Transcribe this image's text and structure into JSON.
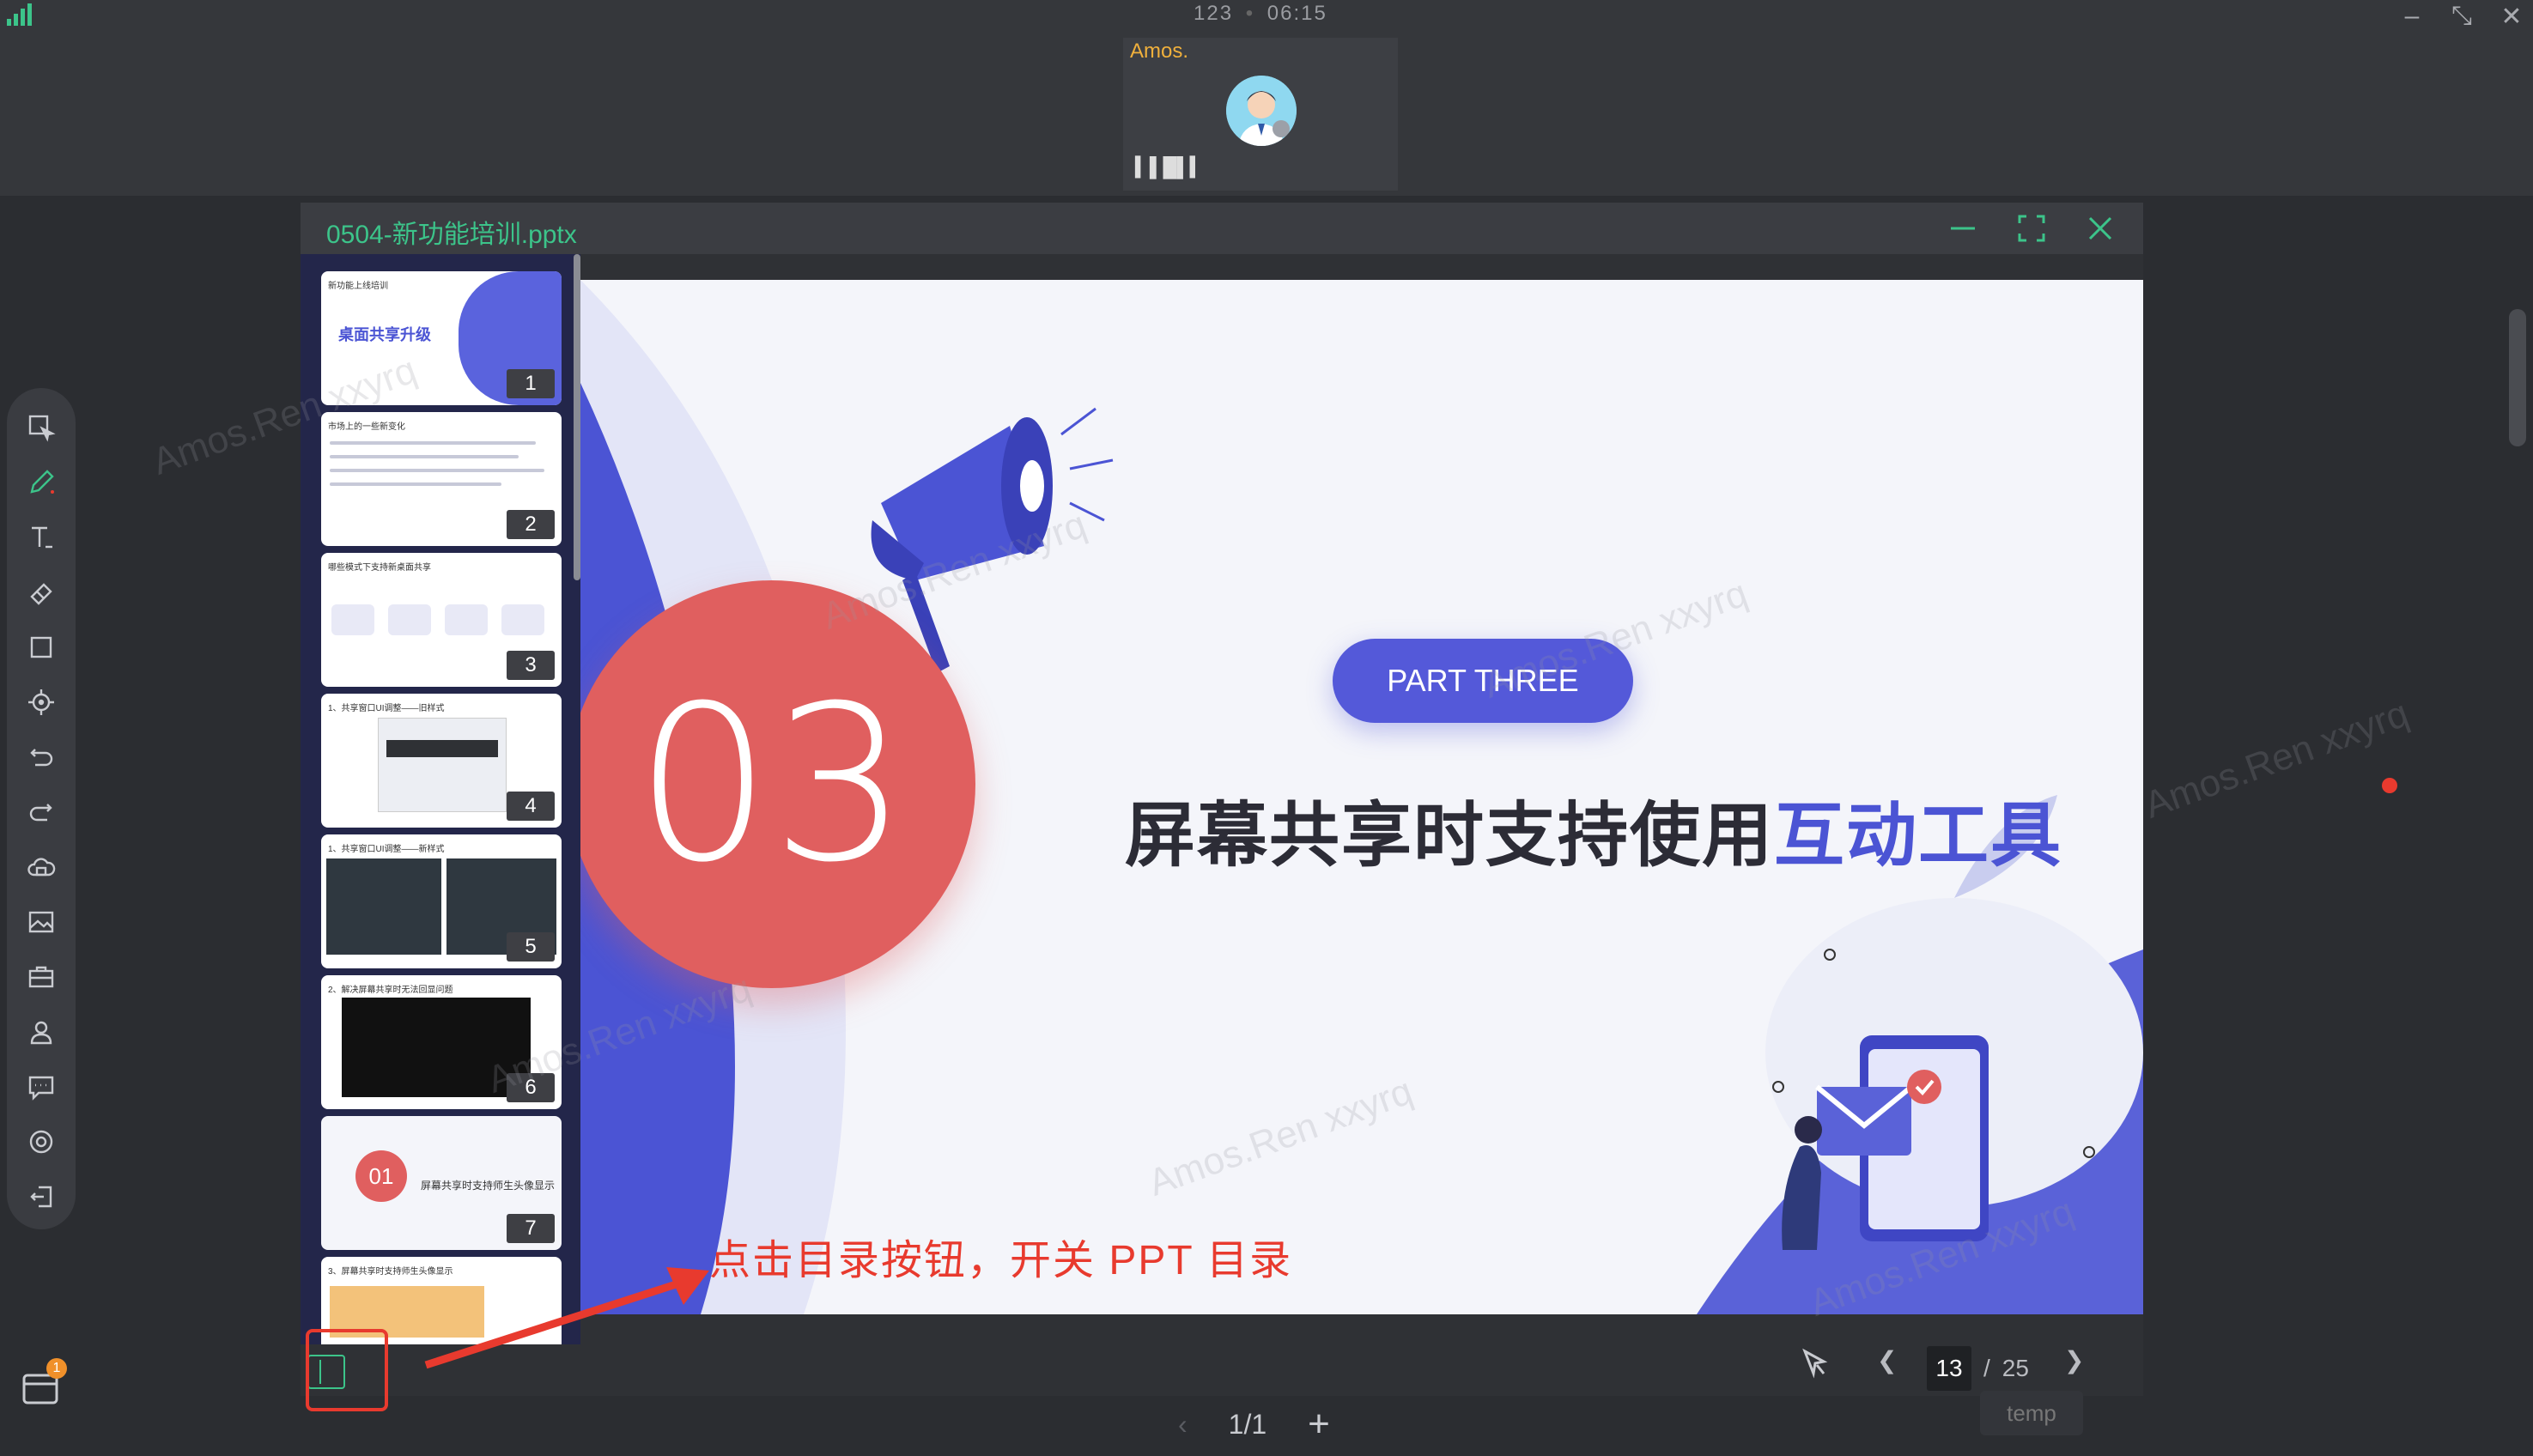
{
  "topbar": {
    "meeting_id": "123",
    "time": "06:15",
    "separator": "•",
    "minimize_icon": "minimize-icon",
    "restore_icon": "restore-icon",
    "close_icon": "close-icon"
  },
  "participant": {
    "name": "Amos.",
    "mic_icon": "audio-wave-icon"
  },
  "toolbar": {
    "tools": [
      {
        "name": "select-tool",
        "icon": "cursor-select-icon"
      },
      {
        "name": "pen-tool",
        "icon": "pen-icon",
        "active": true
      },
      {
        "name": "text-tool",
        "icon": "text-icon"
      },
      {
        "name": "eraser-tool",
        "icon": "eraser-icon"
      },
      {
        "name": "shape-tool",
        "icon": "rectangle-icon"
      },
      {
        "name": "laser-tool",
        "icon": "laser-pointer-icon"
      },
      {
        "name": "undo-tool",
        "icon": "undo-icon"
      },
      {
        "name": "redo-tool",
        "icon": "redo-icon"
      },
      {
        "name": "cloud-tool",
        "icon": "cloud-upload-icon"
      },
      {
        "name": "image-tool",
        "icon": "image-icon"
      },
      {
        "name": "toolbox-tool",
        "icon": "toolbox-icon"
      },
      {
        "name": "member-tool",
        "icon": "user-icon"
      },
      {
        "name": "chat-tool",
        "icon": "chat-icon"
      },
      {
        "name": "record-tool",
        "icon": "record-icon"
      },
      {
        "name": "exit-tool",
        "icon": "exit-icon"
      }
    ],
    "app_badge": "1"
  },
  "viewer": {
    "file_name": "0504-新功能培训.pptx",
    "accent": "#3cc48a",
    "thumbnails": [
      {
        "num": "1",
        "title": "新功能上线培训"
      },
      {
        "num": "2",
        "title": "市场上的一些新变化"
      },
      {
        "num": "3",
        "title": "哪些模式下支持新桌面共享"
      },
      {
        "num": "4",
        "title": "1、共享窗口UI调整——旧样式"
      },
      {
        "num": "5",
        "title": "1、共享窗口UI调整——新样式"
      },
      {
        "num": "6",
        "title": "2、解决屏幕共享时无法回显问题"
      },
      {
        "num": "7",
        "title": "屏幕共享时支持师生头像显示"
      },
      {
        "num": "",
        "title": "3、屏幕共享时支持师生头像显示"
      }
    ],
    "slide": {
      "part_label": "PART THREE",
      "section_number": "03",
      "headline_main": "屏幕共享时支持使用",
      "headline_highlight": "互动工具",
      "red": "#e05f5f",
      "blue": "#5459d9"
    },
    "pager": {
      "current": "13",
      "separator": "/",
      "total": "25"
    }
  },
  "annotation": {
    "text": "点击目录按钮，开关 PPT 目录",
    "color": "#e83a2e"
  },
  "board_pager": {
    "value": "1/1",
    "add": "+",
    "prev": "‹"
  },
  "temp_label": "temp",
  "watermark": "Amos.Ren xxyrq"
}
